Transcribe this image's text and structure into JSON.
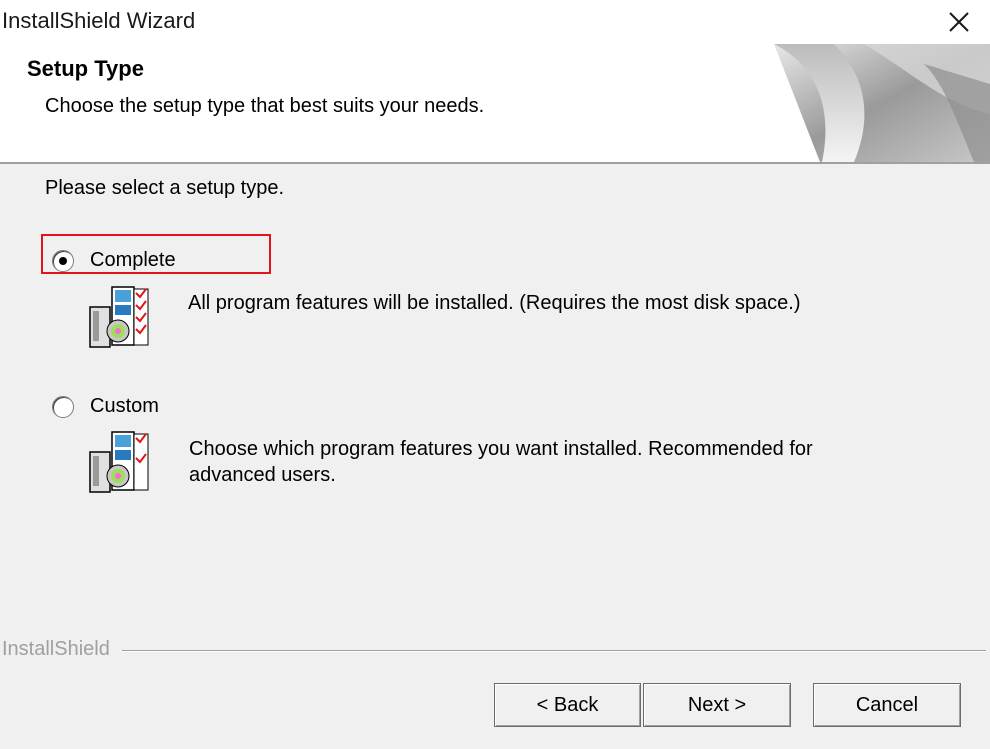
{
  "window": {
    "title": "InstallShield Wizard"
  },
  "header": {
    "title": "Setup Type",
    "subtitle": "Choose the setup type that best suits your needs."
  },
  "main": {
    "instruction": "Please select a setup type.",
    "options": [
      {
        "label": "Complete",
        "selected": true,
        "description": "All program features will be installed. (Requires the most disk space.)"
      },
      {
        "label": "Custom",
        "selected": false,
        "description_line1": "Choose which program features you want installed. Recommended for",
        "description_line2": "advanced users."
      }
    ]
  },
  "footer": {
    "brand": "InstallShield",
    "back_label": "< Back",
    "next_label": "Next >",
    "cancel_label": "Cancel"
  },
  "icons": {
    "close": "close-icon",
    "setup": "setup-type-icon",
    "header_art": "page-curl-graphic"
  },
  "colors": {
    "highlight": "#e0141b",
    "dialog_bg": "#f0f0f0",
    "header_bg": "#ffffff"
  }
}
